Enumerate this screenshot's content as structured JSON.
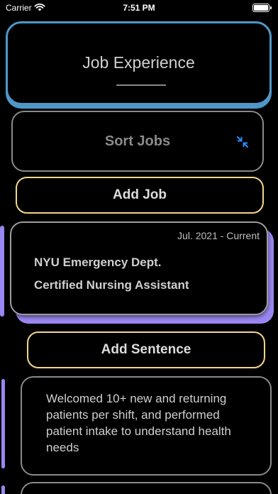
{
  "status_bar": {
    "carrier": "Carrier",
    "time": "7:51 PM"
  },
  "header": {
    "title": "Job Experience"
  },
  "actions": {
    "sort_label": "Sort Jobs",
    "add_job_label": "Add Job",
    "add_sentence_label": "Add Sentence"
  },
  "job": {
    "dates": "Jul. 2021 - Current",
    "employer": "NYU Emergency Dept.",
    "title": "Certified Nursing Assistant"
  },
  "sentences": [
    {
      "text": "Welcomed 10+ new and returning patients per shift, and performed patient intake to understand health needs"
    }
  ],
  "colors": {
    "header_accent": "#4f97c9",
    "job_accent": "#9a86f0",
    "button_border": "#f2d68c",
    "sort_icon": "#2b8cff"
  },
  "icons": {
    "wifi": "wifi-icon",
    "battery": "battery-icon",
    "sort": "collapse-arrows-icon"
  }
}
